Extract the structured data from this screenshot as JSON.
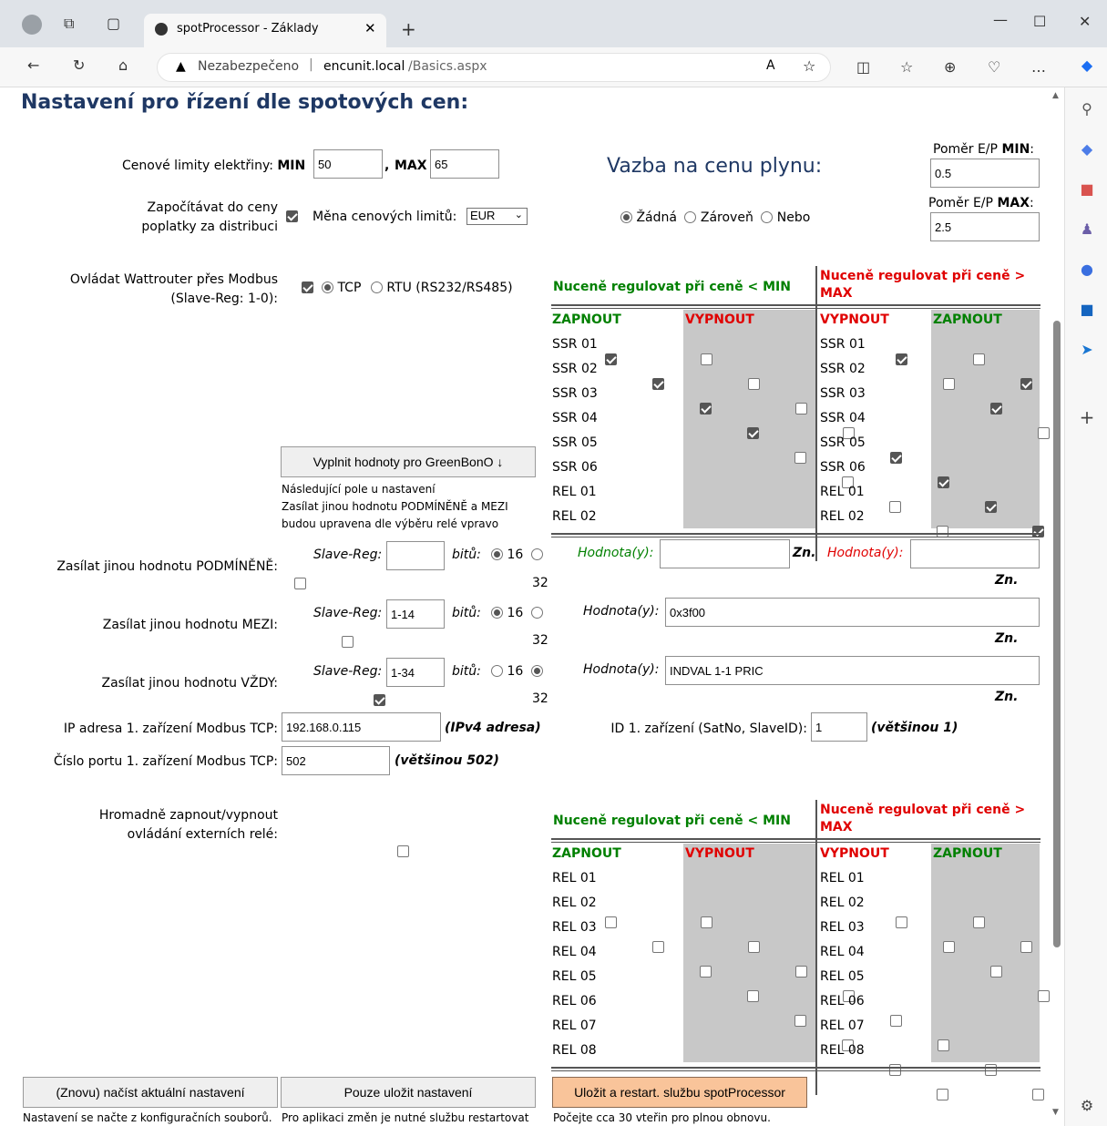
{
  "browser": {
    "tab_title": "spotProcessor - Základy",
    "not_secure": "Nezabezpečeno",
    "url_host": "encunit.local",
    "url_path": "/Basics.aspx"
  },
  "page": {
    "heading": "Nastavení pro řízení dle spotových cen:",
    "price_limits_label": "Cenové limity elektřiny:",
    "min_label": "MIN",
    "min_value": "50",
    "max_label": "MAX",
    "max_value": "65",
    "comma": ",",
    "gas_title": "Vazba na cenu plynu:",
    "ratio_min_label": "Poměr E/P",
    "ratio_min_bold": "MIN",
    "ratio_min_value": "0.5",
    "ratio_max_label": "Poměr E/P",
    "ratio_max_bold": "MAX",
    "ratio_max_value": "2.5",
    "colon": ":",
    "include_fees_line1": "Započítávat do ceny",
    "include_fees_line2": "poplatky za distribuci",
    "currency_label": "Měna cenových limitů:",
    "currency_value": "EUR",
    "gas_opt_none": "Žádná",
    "gas_opt_both": "Zároveň",
    "gas_opt_or": "Nebo",
    "modbus_line1": "Ovládat Wattrouter přes Modbus",
    "modbus_line2": "(Slave-Reg: 1-0):",
    "tcp": "TCP",
    "rtu": "RTU (RS232/RS485)",
    "fill_btn": "Vyplnit hodnoty pro GreenBonO ↓",
    "fill_note1": "Následující pole u nastavení",
    "fill_note2": "Zasílat jinou hodnotu PODMÍNĚNĚ a MEZI",
    "fill_note3": "budou upravena dle výběru relé vpravo",
    "send_cond": "Zasílat jinou hodnotu PODMÍNĚNĚ:",
    "send_mezi": "Zasílat jinou hodnotu MEZI:",
    "send_always": "Zasílat jinou hodnotu VŽDY:",
    "slave_reg": "Slave-Reg:",
    "bits": "bitů:",
    "b16": "16",
    "b32": "32",
    "mezi_reg": "1-14",
    "always_reg": "1-34",
    "hodnoty": "Hodnota(y):",
    "zn": "Zn.",
    "mezi_val": "0x3f00",
    "always_val": "INDVAL 1-1 PRIC",
    "ip_label": "IP adresa 1. zařízení Modbus TCP:",
    "ip_value": "192.168.0.115",
    "ip_hint": "(IPv4 adresa)",
    "port_label": "Číslo portu 1. zařízení Modbus TCP:",
    "port_value": "502",
    "port_hint": "(většinou 502)",
    "id_label": "ID 1. zařízení (SatNo, SlaveID):",
    "id_value": "1",
    "id_hint": "(většinou 1)",
    "bulk_line1": "Hromadně zapnout/vypnout",
    "bulk_line2": "ovládání externích relé:",
    "force_min": "Nuceně regulovat při ceně < MIN",
    "force_max_1": "Nuceně regulovat při ceně >",
    "force_max_2": "MAX",
    "on": "ZAPNOUT",
    "off": "VYPNOUT",
    "btn_reload": "(Znovu) načíst aktuální nastavení",
    "btn_save": "Pouze uložit nastavení",
    "btn_save_restart": "Uložit a restart. službu spotProcessor",
    "note_reload": "Nastavení se načte z konfiguračních souborů.",
    "note_save": "Pro aplikaci změn je nutné službu restartovat",
    "note_restart": "Počejte cca 30 vteřin pro plnou obnovu."
  },
  "table1_rows": [
    {
      "name": "SSR 01",
      "min_on": true,
      "min_off": false,
      "max_name": "SSR 01",
      "max_off": true,
      "max_on": false
    },
    {
      "name": "SSR 02",
      "min_on": true,
      "min_off": false,
      "max_name": "SSR 02",
      "max_off": false,
      "max_on": true
    },
    {
      "name": "SSR 03",
      "min_on": true,
      "min_off": false,
      "max_name": "SSR 03",
      "max_off": true,
      "max_on": false
    },
    {
      "name": "SSR 04",
      "min_on": true,
      "min_off": false,
      "max_name": "SSR 04",
      "max_off": false,
      "max_on": true
    },
    {
      "name": "SSR 05",
      "min_on": false,
      "min_off": true,
      "max_name": "SSR 05",
      "max_off": true,
      "max_on": false
    },
    {
      "name": "SSR 06",
      "min_on": false,
      "min_off": true,
      "max_name": "SSR 06",
      "max_off": false,
      "max_on": true
    },
    {
      "name": "REL 01",
      "min_on": false,
      "min_off": true,
      "max_name": "REL 01",
      "max_off": true,
      "max_on": false
    },
    {
      "name": "REL 02",
      "min_on": false,
      "min_off": true,
      "max_name": "REL 02",
      "max_off": false,
      "max_on": true
    }
  ],
  "table2_rows": [
    "REL 01",
    "REL 02",
    "REL 03",
    "REL 04",
    "REL 05",
    "REL 06",
    "REL 07",
    "REL 08"
  ]
}
